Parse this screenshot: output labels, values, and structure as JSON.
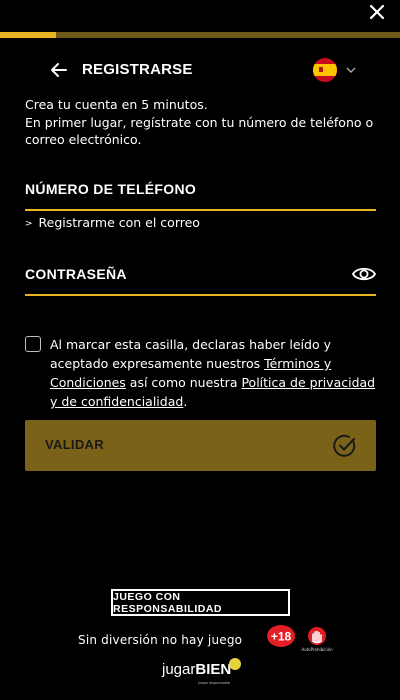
{
  "progress": {
    "fraction": 0.14
  },
  "header": {
    "title": "REGISTRARSE",
    "language_flag": "spain-flag-icon"
  },
  "intro": {
    "line1": "Crea tu cuenta en 5 minutos.",
    "line2": "En primer lugar, regístrate con tu número de teléfono o correo electrónico."
  },
  "form": {
    "phone_label": "NÚMERO DE TELÉFONO",
    "email_link": "Registrarme con el correo",
    "email_link_icon": "chevron-right-icon",
    "password_label": "CONTRASEÑA",
    "password_toggle_icon": "eye-icon"
  },
  "terms": {
    "text_before": "Al marcar esta casilla, declaras haber leído y aceptado expresamente nuestros ",
    "terms_link": "Términos y Condiciones",
    "text_middle": " así como nuestra ",
    "privacy_link": "Política de privacidad y de confidencialidad",
    "text_after": ".",
    "checked": false
  },
  "validate": {
    "label": "VALIDAR",
    "icon": "check-circle-icon"
  },
  "footer": {
    "responsible_label": "JUEGO CON RESPONSABILIDAD",
    "tagline": "Sin diversión no hay juego",
    "age_badge": "+18",
    "autoprohibition_caption": "AutoProhibición",
    "logo_light": "jugar",
    "logo_bold": "BIEN",
    "logo_suffix": ".es",
    "logo_sub": "juego responsable"
  },
  "colors": {
    "accent": "#e9b321",
    "button_bg": "#7a6318",
    "background": "#000000"
  }
}
